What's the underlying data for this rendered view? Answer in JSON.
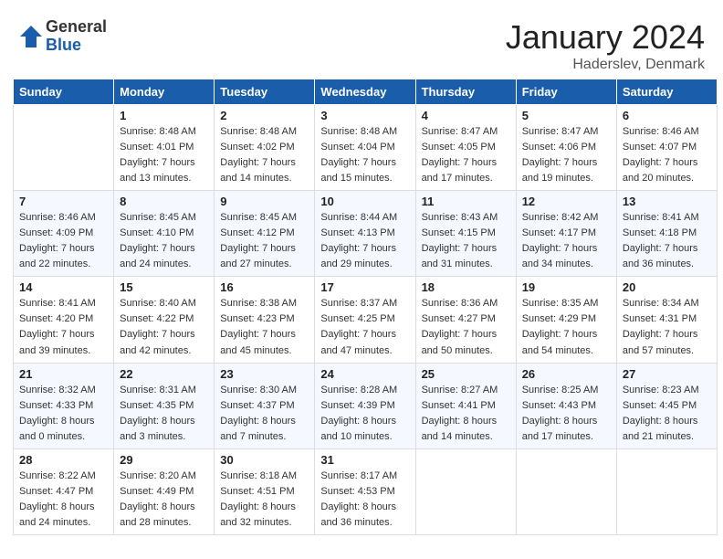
{
  "logo": {
    "general": "General",
    "blue": "Blue"
  },
  "title": "January 2024",
  "location": "Haderslev, Denmark",
  "days_of_week": [
    "Sunday",
    "Monday",
    "Tuesday",
    "Wednesday",
    "Thursday",
    "Friday",
    "Saturday"
  ],
  "weeks": [
    [
      {
        "day": "",
        "sunrise": "",
        "sunset": "",
        "daylight": ""
      },
      {
        "day": "1",
        "sunrise": "Sunrise: 8:48 AM",
        "sunset": "Sunset: 4:01 PM",
        "daylight": "Daylight: 7 hours and 13 minutes."
      },
      {
        "day": "2",
        "sunrise": "Sunrise: 8:48 AM",
        "sunset": "Sunset: 4:02 PM",
        "daylight": "Daylight: 7 hours and 14 minutes."
      },
      {
        "day": "3",
        "sunrise": "Sunrise: 8:48 AM",
        "sunset": "Sunset: 4:04 PM",
        "daylight": "Daylight: 7 hours and 15 minutes."
      },
      {
        "day": "4",
        "sunrise": "Sunrise: 8:47 AM",
        "sunset": "Sunset: 4:05 PM",
        "daylight": "Daylight: 7 hours and 17 minutes."
      },
      {
        "day": "5",
        "sunrise": "Sunrise: 8:47 AM",
        "sunset": "Sunset: 4:06 PM",
        "daylight": "Daylight: 7 hours and 19 minutes."
      },
      {
        "day": "6",
        "sunrise": "Sunrise: 8:46 AM",
        "sunset": "Sunset: 4:07 PM",
        "daylight": "Daylight: 7 hours and 20 minutes."
      }
    ],
    [
      {
        "day": "7",
        "sunrise": "Sunrise: 8:46 AM",
        "sunset": "Sunset: 4:09 PM",
        "daylight": "Daylight: 7 hours and 22 minutes."
      },
      {
        "day": "8",
        "sunrise": "Sunrise: 8:45 AM",
        "sunset": "Sunset: 4:10 PM",
        "daylight": "Daylight: 7 hours and 24 minutes."
      },
      {
        "day": "9",
        "sunrise": "Sunrise: 8:45 AM",
        "sunset": "Sunset: 4:12 PM",
        "daylight": "Daylight: 7 hours and 27 minutes."
      },
      {
        "day": "10",
        "sunrise": "Sunrise: 8:44 AM",
        "sunset": "Sunset: 4:13 PM",
        "daylight": "Daylight: 7 hours and 29 minutes."
      },
      {
        "day": "11",
        "sunrise": "Sunrise: 8:43 AM",
        "sunset": "Sunset: 4:15 PM",
        "daylight": "Daylight: 7 hours and 31 minutes."
      },
      {
        "day": "12",
        "sunrise": "Sunrise: 8:42 AM",
        "sunset": "Sunset: 4:17 PM",
        "daylight": "Daylight: 7 hours and 34 minutes."
      },
      {
        "day": "13",
        "sunrise": "Sunrise: 8:41 AM",
        "sunset": "Sunset: 4:18 PM",
        "daylight": "Daylight: 7 hours and 36 minutes."
      }
    ],
    [
      {
        "day": "14",
        "sunrise": "Sunrise: 8:41 AM",
        "sunset": "Sunset: 4:20 PM",
        "daylight": "Daylight: 7 hours and 39 minutes."
      },
      {
        "day": "15",
        "sunrise": "Sunrise: 8:40 AM",
        "sunset": "Sunset: 4:22 PM",
        "daylight": "Daylight: 7 hours and 42 minutes."
      },
      {
        "day": "16",
        "sunrise": "Sunrise: 8:38 AM",
        "sunset": "Sunset: 4:23 PM",
        "daylight": "Daylight: 7 hours and 45 minutes."
      },
      {
        "day": "17",
        "sunrise": "Sunrise: 8:37 AM",
        "sunset": "Sunset: 4:25 PM",
        "daylight": "Daylight: 7 hours and 47 minutes."
      },
      {
        "day": "18",
        "sunrise": "Sunrise: 8:36 AM",
        "sunset": "Sunset: 4:27 PM",
        "daylight": "Daylight: 7 hours and 50 minutes."
      },
      {
        "day": "19",
        "sunrise": "Sunrise: 8:35 AM",
        "sunset": "Sunset: 4:29 PM",
        "daylight": "Daylight: 7 hours and 54 minutes."
      },
      {
        "day": "20",
        "sunrise": "Sunrise: 8:34 AM",
        "sunset": "Sunset: 4:31 PM",
        "daylight": "Daylight: 7 hours and 57 minutes."
      }
    ],
    [
      {
        "day": "21",
        "sunrise": "Sunrise: 8:32 AM",
        "sunset": "Sunset: 4:33 PM",
        "daylight": "Daylight: 8 hours and 0 minutes."
      },
      {
        "day": "22",
        "sunrise": "Sunrise: 8:31 AM",
        "sunset": "Sunset: 4:35 PM",
        "daylight": "Daylight: 8 hours and 3 minutes."
      },
      {
        "day": "23",
        "sunrise": "Sunrise: 8:30 AM",
        "sunset": "Sunset: 4:37 PM",
        "daylight": "Daylight: 8 hours and 7 minutes."
      },
      {
        "day": "24",
        "sunrise": "Sunrise: 8:28 AM",
        "sunset": "Sunset: 4:39 PM",
        "daylight": "Daylight: 8 hours and 10 minutes."
      },
      {
        "day": "25",
        "sunrise": "Sunrise: 8:27 AM",
        "sunset": "Sunset: 4:41 PM",
        "daylight": "Daylight: 8 hours and 14 minutes."
      },
      {
        "day": "26",
        "sunrise": "Sunrise: 8:25 AM",
        "sunset": "Sunset: 4:43 PM",
        "daylight": "Daylight: 8 hours and 17 minutes."
      },
      {
        "day": "27",
        "sunrise": "Sunrise: 8:23 AM",
        "sunset": "Sunset: 4:45 PM",
        "daylight": "Daylight: 8 hours and 21 minutes."
      }
    ],
    [
      {
        "day": "28",
        "sunrise": "Sunrise: 8:22 AM",
        "sunset": "Sunset: 4:47 PM",
        "daylight": "Daylight: 8 hours and 24 minutes."
      },
      {
        "day": "29",
        "sunrise": "Sunrise: 8:20 AM",
        "sunset": "Sunset: 4:49 PM",
        "daylight": "Daylight: 8 hours and 28 minutes."
      },
      {
        "day": "30",
        "sunrise": "Sunrise: 8:18 AM",
        "sunset": "Sunset: 4:51 PM",
        "daylight": "Daylight: 8 hours and 32 minutes."
      },
      {
        "day": "31",
        "sunrise": "Sunrise: 8:17 AM",
        "sunset": "Sunset: 4:53 PM",
        "daylight": "Daylight: 8 hours and 36 minutes."
      },
      {
        "day": "",
        "sunrise": "",
        "sunset": "",
        "daylight": ""
      },
      {
        "day": "",
        "sunrise": "",
        "sunset": "",
        "daylight": ""
      },
      {
        "day": "",
        "sunrise": "",
        "sunset": "",
        "daylight": ""
      }
    ]
  ]
}
